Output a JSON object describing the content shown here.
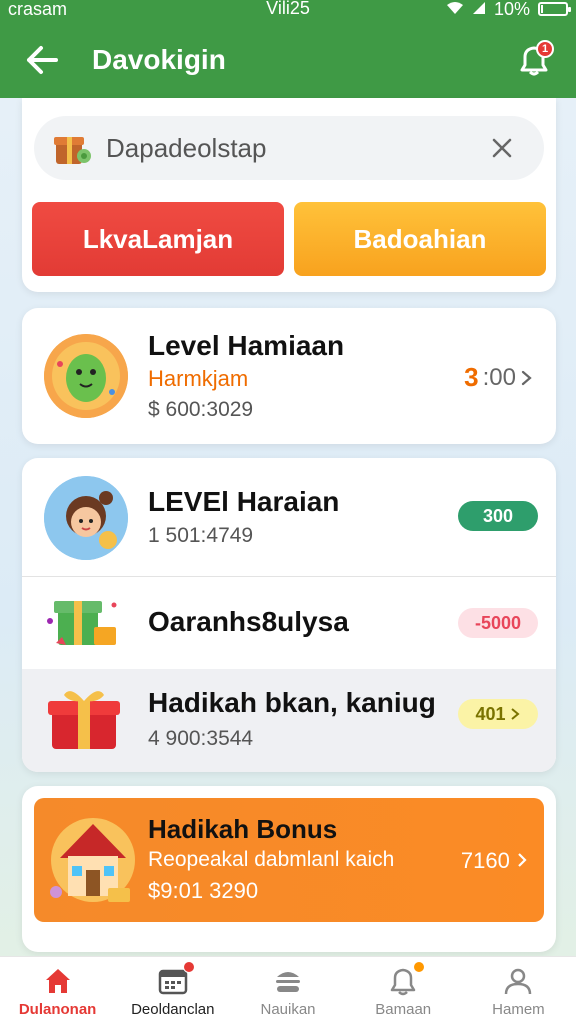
{
  "status_bar": {
    "carrier": "crasam",
    "time": "Vili25",
    "battery": "10%",
    "battery_level": 0.1
  },
  "header": {
    "title": "Davokigin",
    "notification_count": "1"
  },
  "search": {
    "value": "Dapadeolstap",
    "icon": "gift-icon"
  },
  "actions": {
    "primary_label": "LkvaLamjan",
    "secondary_label": "Badoahian"
  },
  "list": [
    {
      "title": "Level Hamiaan",
      "subtitle": "Harmkjam",
      "meta": "$ 600:3029",
      "value_strong": "3",
      "value_rest": ":00",
      "icon": "dinosaur-avatar"
    },
    {
      "title": "LEVEl Haraian",
      "meta": "1 501:4749",
      "pill": "300",
      "pill_color": "#2e9e6c",
      "icon": "girl-avatar"
    },
    {
      "title": "Oaranhs8ulysa",
      "pill": "-5000",
      "pill_color": "#e8455a",
      "icon": "gift-box-icon"
    },
    {
      "title": "Hadikah bkan, kaniug",
      "meta": "4 900:3544",
      "pill": "401",
      "pill_color": "#a8a000",
      "icon": "red-gift-icon"
    }
  ],
  "bonus": {
    "title": "Hadikah Bonus",
    "subtitle": "Reopeakal dabmlanl kaich",
    "meta": "$9:01 3290",
    "value": "7160",
    "icon": "house-icon"
  },
  "tabs": [
    {
      "label": "Dulanonan",
      "icon": "home-icon",
      "state": "active"
    },
    {
      "label": "Deoldanclan",
      "icon": "calendar-icon",
      "state": "dark"
    },
    {
      "label": "Nauikan",
      "icon": "burger-icon",
      "state": "normal"
    },
    {
      "label": "Bamaan",
      "icon": "bell-icon",
      "state": "normal"
    },
    {
      "label": "Hamem",
      "icon": "user-icon",
      "state": "normal"
    }
  ],
  "colors": {
    "brand_green": "#3f9a45",
    "primary_red": "#e23b35",
    "secondary_orange": "#f8a21e",
    "bonus_orange": "#f58a2a"
  }
}
